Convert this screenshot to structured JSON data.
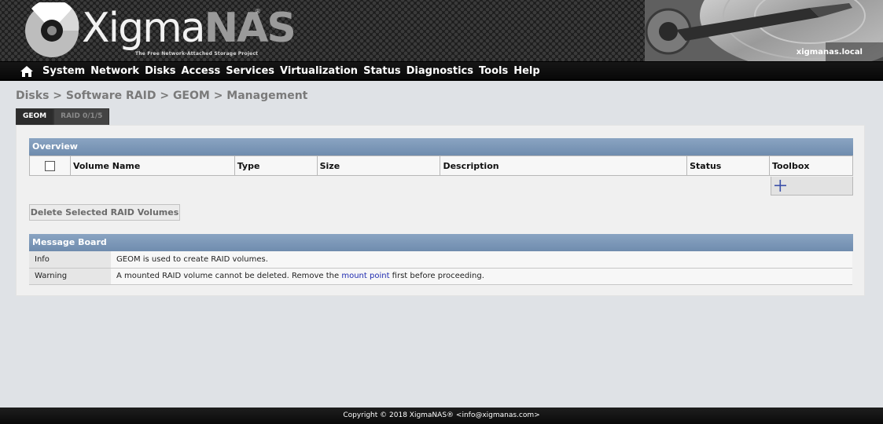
{
  "brand": {
    "word_main": "Xigma",
    "word_accent": "NAS",
    "registered": "®",
    "tagline": "The Free Network-Attached Storage Project",
    "hostname": "xigmanas.local"
  },
  "nav": {
    "home_icon": "home-icon",
    "items": [
      "System",
      "Network",
      "Disks",
      "Access",
      "Services",
      "Virtualization",
      "Status",
      "Diagnostics",
      "Tools",
      "Help"
    ]
  },
  "breadcrumb": "Disks > Software RAID > GEOM > Management",
  "tabs": [
    {
      "label": "GEOM",
      "active": true
    },
    {
      "label": "RAID 0/1/5",
      "active": false
    }
  ],
  "overview": {
    "title": "Overview",
    "columns": [
      "Volume Name",
      "Type",
      "Size",
      "Description",
      "Status",
      "Toolbox"
    ],
    "rows": [],
    "toolbox_icon": "plus-icon"
  },
  "actions": {
    "delete_label": "Delete Selected RAID Volumes"
  },
  "message_board": {
    "title": "Message Board",
    "messages": [
      {
        "label": "Info",
        "text": "GEOM is used to create RAID volumes."
      },
      {
        "label": "Warning",
        "text_before": "A mounted RAID volume cannot be deleted. Remove the ",
        "link": "mount point",
        "text_after": " first before proceeding."
      }
    ]
  },
  "footer": {
    "copyright": "Copyright © 2018 XigmaNAS® <info@xigmanas.com>"
  },
  "colors": {
    "section_bar": "#7b96b7",
    "nav_bg": "#111111",
    "link": "#1f2bb0",
    "page_bg": "#dfe2e6"
  }
}
